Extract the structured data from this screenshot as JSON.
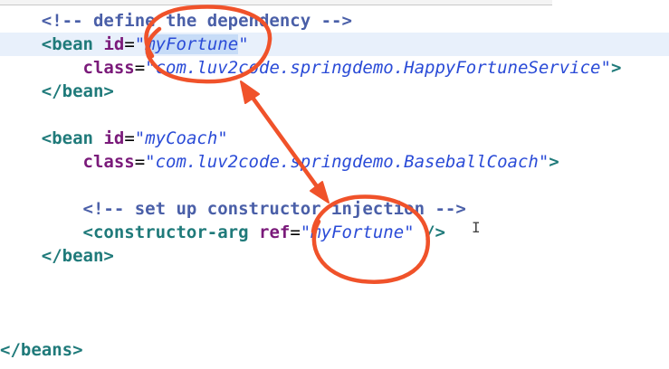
{
  "editor": {
    "lines": {
      "l1": {
        "indent": "    ",
        "comment": "<!-- define the dependency -->"
      },
      "l2": {
        "indent": "    ",
        "open": "<",
        "tag": "bean",
        "attr": "id",
        "eq": "=",
        "q1": "\"",
        "val": "myFortune",
        "q2": "\""
      },
      "l3": {
        "indent": "        ",
        "attr": "class",
        "eq": "=",
        "val": "\"com.luv2code.springdemo.HappyFortuneService\"",
        "close": ">"
      },
      "l4": {
        "indent": "    ",
        "tag": "</bean>"
      },
      "l6": {
        "indent": "    ",
        "open": "<",
        "tag": "bean",
        "attr": "id",
        "eq": "=",
        "val": "\"myCoach\""
      },
      "l7": {
        "indent": "        ",
        "attr": "class",
        "eq": "=",
        "val": "\"com.luv2code.springdemo.BaseballCoach\"",
        "close": ">"
      },
      "l9": {
        "indent": "        ",
        "comment": "<!-- set up constructor injection -->"
      },
      "l10": {
        "indent": "        ",
        "open": "<",
        "tag": "constructor-arg",
        "attr": "ref",
        "eq": "=",
        "val": "\"myFortune\"",
        "close": " />"
      },
      "l11": {
        "indent": "    ",
        "tag": "</bean>"
      },
      "l15": {
        "tag": "</beans>"
      }
    },
    "cursor_glyph": "I"
  },
  "annotations": {
    "color": "#f0522a",
    "circles": 2,
    "arrow": "double-headed"
  }
}
